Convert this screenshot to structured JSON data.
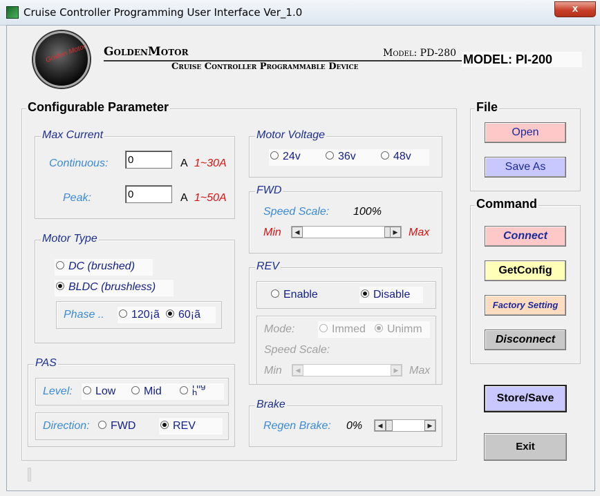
{
  "window": {
    "title": "Cruise Controller Programming User Interface Ver_1.0",
    "close_label": "x"
  },
  "header": {
    "logo_text": "Golden Motor",
    "brand_name": "GoldenMotor",
    "model_pd": "Model: PD-280",
    "subtitle": "Cruise Controller Programmable Device",
    "model_pi": "MODEL: PI-200"
  },
  "config": {
    "title": "Configurable Parameter",
    "max_current": {
      "title": "Max Current",
      "continuous_label": "Continuous:",
      "continuous_value": "0",
      "peak_label": "Peak:",
      "peak_value": "0",
      "unit": "A",
      "continuous_range": "1~30A",
      "peak_range": "1~50A"
    },
    "motor_type": {
      "title": "Motor Type",
      "dc": "DC (brushed)",
      "bldc": "BLDC (brushless)",
      "phase_label": "Phase ..",
      "phase_120": "120¡ã",
      "phase_60": "60¡ã"
    },
    "pas": {
      "title": "PAS",
      "level_label": "Level:",
      "low": "Low",
      "mid": "Mid",
      "high": "High",
      "direction_label": "Direction:",
      "fwd": "FWD",
      "rev": "REV"
    },
    "motor_voltage": {
      "title": "Motor Voltage",
      "v24": "24v",
      "v36": "36v",
      "v48": "48v"
    },
    "fwd": {
      "title": "FWD",
      "speed_label": "Speed Scale:",
      "speed_value": "100%",
      "min": "Min",
      "max": "Max",
      "speed_fraction": 1.0
    },
    "rev": {
      "title": "REV",
      "enable": "Enable",
      "disable": "Disable",
      "mode_label": "Mode:",
      "immed": "Immed",
      "unimm": "Unimm",
      "speed_label": "Speed Scale:",
      "min": "Min",
      "max": "Max"
    },
    "brake": {
      "title": "Brake",
      "regen_label": "Regen Brake:",
      "regen_value": "0%"
    }
  },
  "file": {
    "title": "File",
    "open": "Open",
    "save_as": "Save As"
  },
  "command": {
    "title": "Command",
    "connect": "Connect",
    "get_config": "GetConfig",
    "factory": "Factory Setting",
    "disconnect": "Disconnect"
  },
  "store_save": "Store/Save",
  "exit": "Exit",
  "colors": {
    "accent_red": "#e01010",
    "label_blue": "#3a8ad8",
    "radio_navy": "#14208a"
  }
}
